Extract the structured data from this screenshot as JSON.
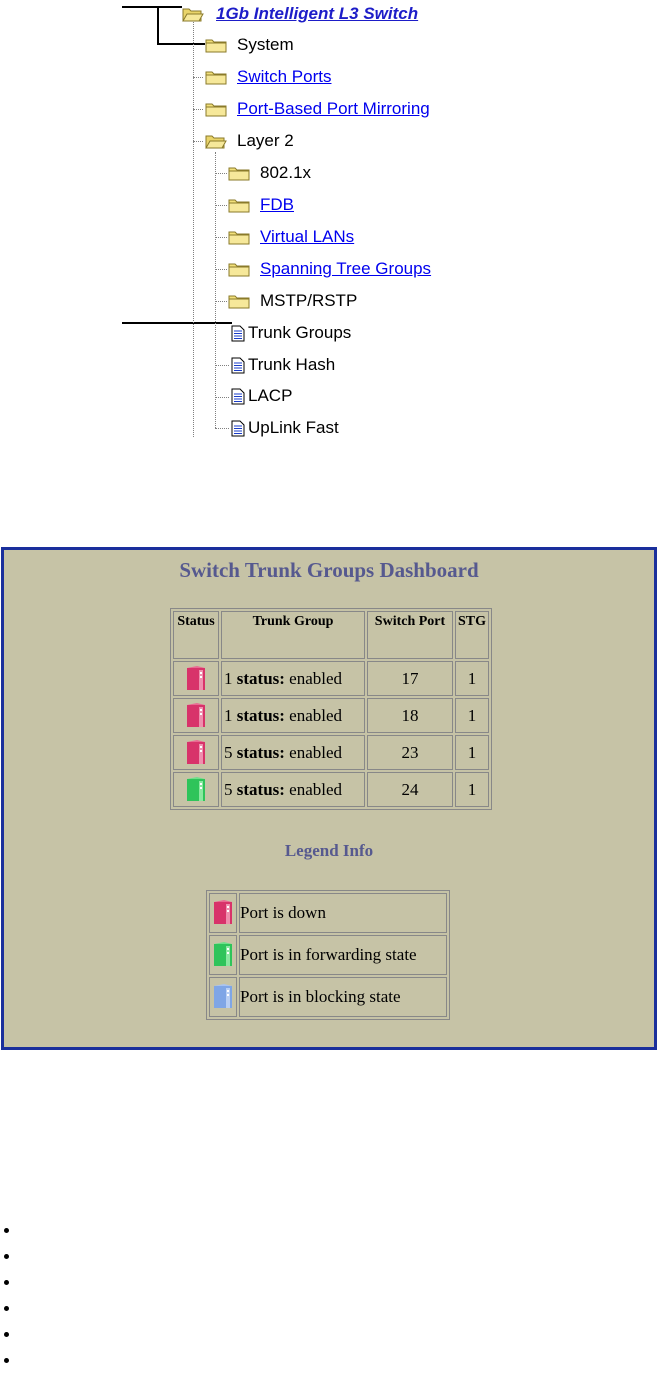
{
  "tree": {
    "root_label": "1Gb Intelligent L3 Switch",
    "items": [
      {
        "label": "System",
        "type": "folder",
        "link": false
      },
      {
        "label": "Switch Ports",
        "type": "folder",
        "link": true
      },
      {
        "label": "Port-Based Port Mirroring",
        "type": "folder",
        "link": true
      },
      {
        "label": "Layer 2",
        "type": "folder-open",
        "link": false
      }
    ],
    "layer2_items": [
      {
        "label": "802.1x",
        "type": "folder",
        "link": false
      },
      {
        "label": "FDB",
        "type": "folder",
        "link": true
      },
      {
        "label": "Virtual LANs",
        "type": "folder",
        "link": true
      },
      {
        "label": "Spanning Tree Groups",
        "type": "folder",
        "link": true
      },
      {
        "label": "MSTP/RSTP",
        "type": "folder",
        "link": false
      },
      {
        "label": "Trunk Groups",
        "type": "document",
        "link": false
      },
      {
        "label": "Trunk Hash",
        "type": "document",
        "link": false
      },
      {
        "label": "LACP",
        "type": "document",
        "link": false
      },
      {
        "label": "UpLink Fast",
        "type": "document",
        "link": false
      }
    ]
  },
  "dashboard": {
    "title": "Switch Trunk Groups Dashboard",
    "columns": [
      "Status",
      "Trunk Group",
      "Switch Port",
      "STG"
    ],
    "status_word": "status:",
    "rows": [
      {
        "status": "down",
        "trunk_group": "1",
        "state": "enabled",
        "switch_port": "17",
        "stg": "1"
      },
      {
        "status": "down",
        "trunk_group": "1",
        "state": "enabled",
        "switch_port": "18",
        "stg": "1"
      },
      {
        "status": "down",
        "trunk_group": "5",
        "state": "enabled",
        "switch_port": "23",
        "stg": "1"
      },
      {
        "status": "forwarding",
        "trunk_group": "5",
        "state": "enabled",
        "switch_port": "24",
        "stg": "1"
      }
    ],
    "legend_title": "Legend Info",
    "legend": [
      {
        "status": "down",
        "label": "Port is down"
      },
      {
        "status": "forwarding",
        "label": "Port is in forwarding state"
      },
      {
        "status": "blocking",
        "label": "Port is in blocking state"
      }
    ],
    "colors": {
      "down": "#d8336a",
      "forwarding": "#2fc45a",
      "blocking": "#7fa6e6",
      "panel_bg": "#c6c3a6",
      "panel_border": "#1a2f9c",
      "title": "#56598f"
    }
  },
  "bullets_count": 6
}
